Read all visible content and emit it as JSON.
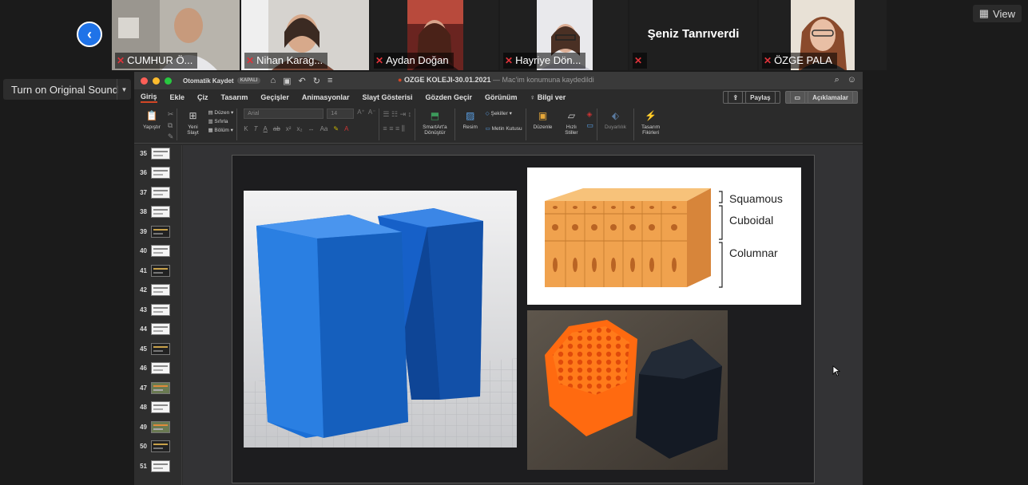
{
  "meeting": {
    "participants": [
      {
        "name": "CUMHUR Ö...",
        "muted": true,
        "video": true
      },
      {
        "name": "Nihan Karag...",
        "muted": true,
        "video": true
      },
      {
        "name": "Aydan Doğan",
        "muted": true,
        "video": true
      },
      {
        "name": "Hayriye Dön...",
        "muted": true,
        "video": true
      },
      {
        "name": "Şeniz Tanrıverdi",
        "muted": true,
        "video": false
      },
      {
        "name": "ÖZGE PALA",
        "muted": true,
        "video": true
      }
    ],
    "view_label": "View",
    "original_sound_label": "Turn on Original Sound"
  },
  "ppt": {
    "autosave_label": "Otomatik Kaydet",
    "autosave_state": "KAPALI",
    "doc_name": "OZGE KOLEJI-30.01.2021",
    "doc_status": "— Mac'im konumuna kaydedildi",
    "tabs": [
      "Giriş",
      "Ekle",
      "Çiz",
      "Tasarım",
      "Geçişler",
      "Animasyonlar",
      "Slayt Gösterisi",
      "Gözden Geçir",
      "Görünüm",
      "Bilgi ver"
    ],
    "share_label": "Paylaş",
    "comments_label": "Açıklamalar",
    "ribbon": {
      "paste": "Yapıştır",
      "new_slide_1": "Yeni",
      "new_slide_2": "Slayt",
      "layout": "Düzen",
      "reset": "Sıfırla",
      "section": "Bölüm",
      "font": "Arial",
      "size": "14",
      "smartart_1": "SmartArt'a",
      "smartart_2": "Dönüştür",
      "picture": "Resim",
      "shapes": "Şekiller",
      "textbox": "Metin Kutusu",
      "arrange": "Düzenle",
      "quick_1": "Hızlı",
      "quick_2": "Stiller",
      "sensitivity": "Duyarlılık",
      "design_1": "Tasarım",
      "design_2": "Fikirleri"
    },
    "slide_numbers": [
      "35",
      "36",
      "37",
      "38",
      "39",
      "40",
      "41",
      "42",
      "43",
      "44",
      "45",
      "46",
      "47",
      "48",
      "49",
      "50",
      "51"
    ]
  },
  "slide": {
    "labels": {
      "squamous": "Squamous",
      "cuboidal": "Cuboidal",
      "columnar": "Columnar"
    }
  },
  "colors": {
    "accent_blue": "#1f73e8",
    "mute_red": "#e0333a",
    "ppt_accent": "#d24726",
    "prism_blue": "#1a6fd6",
    "epithelium_orange": "#f0a24e"
  }
}
